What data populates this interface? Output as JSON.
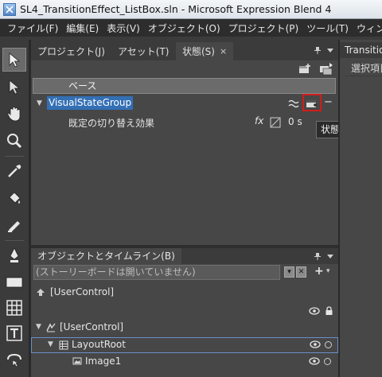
{
  "window": {
    "title": "SL4_TransitionEffect_ListBox.sln - Microsoft Expression Blend 4"
  },
  "menu": [
    "ファイル(F)",
    "編集(E)",
    "表示(V)",
    "オブジェクト(O)",
    "プロジェクト(P)",
    "ツール(T)",
    "ウィンド"
  ],
  "tools": [
    "selection-icon",
    "direct-selection-icon",
    "pan-icon",
    "zoom-icon",
    "eyedropper-icon",
    "paint-bucket-icon",
    "gradient-icon",
    "pen-icon",
    "rectangle-icon",
    "grid-icon",
    "textblock-icon",
    "asset-icon"
  ],
  "tabs": {
    "project": "プロジェクト(J)",
    "assets": "アセット(T)",
    "states": "状態(S)",
    "close_glyph": "×"
  },
  "states": {
    "base_label": "ベース",
    "group_name": "VisualStateGroup",
    "default_transition_label": "既定の切り替え効果",
    "fx_label": "fx",
    "duration": "0 s",
    "remove_glyph": "−",
    "tooltip": "状態の追加"
  },
  "right_panel": {
    "tab": "Transitio",
    "sub": "選択項目"
  },
  "objects_timeline": {
    "tab": "オブジェクトとタイムライン(B)",
    "storyboard_placeholder": "(ストーリーボードは開いていません)",
    "add_glyph": "+",
    "rows": [
      {
        "label": "[UserControl]"
      },
      {
        "label": "[UserControl]"
      },
      {
        "label": "LayoutRoot"
      },
      {
        "label": "Image1"
      }
    ]
  }
}
